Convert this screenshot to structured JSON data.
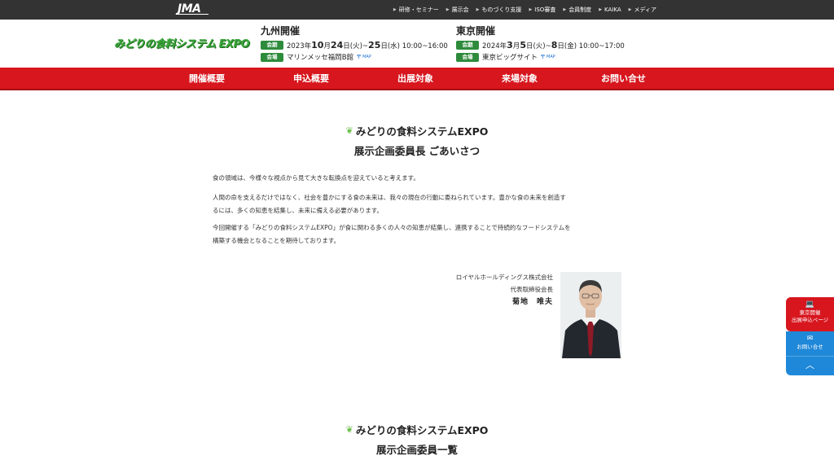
{
  "topbar": {
    "logo": "JMA",
    "links": [
      "研修・セミナー",
      "展示会",
      "ものづくり支援",
      "ISO審査",
      "会員制度",
      "KAIKA",
      "メディア"
    ]
  },
  "header": {
    "expo_logo": "みどりの食料システム EXPO",
    "kyushu": {
      "title": "九州開催",
      "date_badge": "会期",
      "date_pre": "2023年",
      "date_m1": "10",
      "date_t1": "月",
      "date_d1": "24",
      "date_t2": "日(火)~",
      "date_d2": "25",
      "date_t3": "日(水) 10:00~16:00",
      "venue_badge": "会場",
      "venue": "マリンメッセ福岡B館",
      "map": "MAP"
    },
    "tokyo": {
      "title": "東京開催",
      "date_badge": "会期",
      "date_pre": "2024年",
      "date_m1": "3",
      "date_t1": "月",
      "date_d1": "5",
      "date_t2": "日(火)~",
      "date_d2": "8",
      "date_t3": "日(金) 10:00~17:00",
      "venue_badge": "会場",
      "venue": "東京ビッグサイト",
      "map": "MAP"
    }
  },
  "nav": [
    "開催概要",
    "申込概要",
    "出展対象",
    "来場対象",
    "お問い合せ"
  ],
  "section1": {
    "title1": "みどりの食料システムEXPO",
    "title2": "展示企画委員長 ごあいさつ",
    "p1": "食の領域は、今様々な視点から見て大きな転換点を迎えていると考えます。",
    "p2a": "人間の命を支えるだけではなく、社会を豊かにする食の未来は、我々の現在の行動に委ねられています。豊かな食の未来を創造す",
    "p2b": "るには、多くの知恵を結集し、未来に備える必要があります。",
    "p3a": "今回開催する「みどりの食料システムEXPO」が食に関わる多くの人々の知恵が結集し、連携することで持続的なフードシステムを",
    "p3b": "構築する機会となることを期待しております。",
    "company": "ロイヤルホールディングス株式会社",
    "role": "代表取締役会長",
    "name": "菊地　唯夫"
  },
  "section2": {
    "title1": "みどりの食料システムEXPO",
    "title2": "展示企画委員一覧"
  },
  "side": {
    "tokyo_line1": "東京開催",
    "tokyo_line2": "出展申込ページ",
    "contact": "お問い合せ"
  },
  "icons": {
    "sprout": "sprout-icon",
    "laptop": "laptop-icon",
    "mail": "mail-icon",
    "up": "chevron-up-icon"
  },
  "colors": {
    "nav_red": "#d7161e",
    "badge_green": "#2e8b3c",
    "side_blue": "#1f88d8",
    "topbar": "#333333"
  }
}
